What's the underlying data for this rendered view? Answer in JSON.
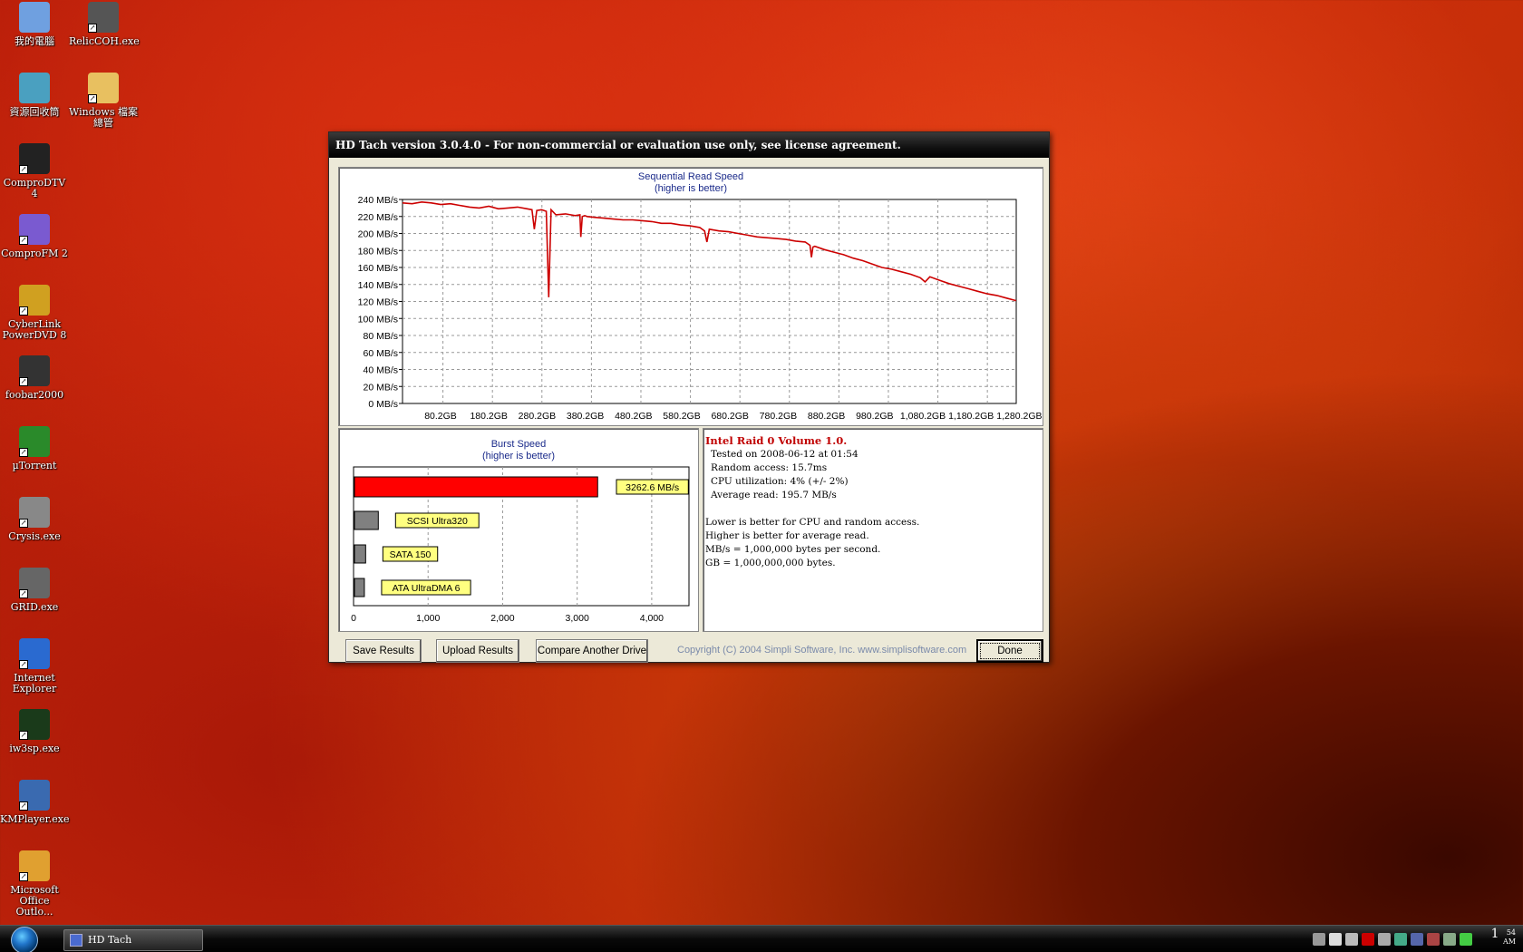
{
  "desktop": {
    "icons": [
      {
        "label": "我的電腦",
        "icon": "my-computer-icon"
      },
      {
        "label": "RelicCOH.exe",
        "icon": "coh-icon"
      },
      {
        "label": "資源回收筒",
        "icon": "recycle-bin-icon"
      },
      {
        "label": "Windows 檔案總管",
        "icon": "explorer-folder-icon"
      },
      {
        "label": "ComproDTV 4",
        "icon": "comprodtv-icon"
      },
      {
        "label": "ComproFM 2",
        "icon": "comprofm-icon"
      },
      {
        "label": "CyberLink PowerDVD 8",
        "icon": "powerdvd-icon"
      },
      {
        "label": "foobar2000",
        "icon": "foobar-icon"
      },
      {
        "label": "µTorrent",
        "icon": "utorrent-icon"
      },
      {
        "label": "Crysis.exe",
        "icon": "crysis-icon"
      },
      {
        "label": "GRID.exe",
        "icon": "grid-icon"
      },
      {
        "label": "Internet Explorer",
        "icon": "ie-icon"
      },
      {
        "label": "iw3sp.exe",
        "icon": "cod4-icon"
      },
      {
        "label": "KMPlayer.exe",
        "icon": "kmplayer-icon"
      },
      {
        "label": "Microsoft Office Outlo...",
        "icon": "outlook-icon"
      }
    ]
  },
  "window": {
    "title": "HD Tach version 3.0.4.0  - For non-commercial or evaluation use only, see license agreement.",
    "buttons": {
      "save": "Save Results",
      "upload": "Upload Results",
      "compare": "Compare Another Drive",
      "done": "Done"
    },
    "copyright": "Copyright (C) 2004 Simpli Software, Inc. www.simplisoftware.com"
  },
  "info": {
    "title": "Intel Raid 0 Volume 1.0.",
    "tested": "Tested on 2008-06-12 at 01:54",
    "random_access": "Random access: 15.7ms",
    "cpu": "CPU utilization: 4% (+/- 2%)",
    "average": "Average read: 195.7 MB/s",
    "note1": "Lower is better for CPU and random access.",
    "note2": "Higher is better for average read.",
    "note3": "MB/s = 1,000,000 bytes per second.",
    "note4": "GB = 1,000,000,000 bytes."
  },
  "chart_data": [
    {
      "type": "line",
      "title": "Sequential Read Speed",
      "subtitle": "(higher is better)",
      "ylim": [
        0,
        240
      ],
      "y_ticks": [
        "0 MB/s",
        "20 MB/s",
        "40 MB/s",
        "60 MB/s",
        "80 MB/s",
        "100 MB/s",
        "120 MB/s",
        "140 MB/s",
        "160 MB/s",
        "180 MB/s",
        "200 MB/s",
        "220 MB/s",
        "240 MB/s"
      ],
      "x_ticks": [
        "80.2GB",
        "180.2GB",
        "280.2GB",
        "380.2GB",
        "480.2GB",
        "580.2GB",
        "680.2GB",
        "780.2GB",
        "880.2GB",
        "980.2GB",
        "1,080.2GB",
        "1,180.2GB",
        "1,280.2GB"
      ],
      "xlim": [
        0,
        1280.2
      ],
      "grid": true,
      "color": "#cc0000",
      "series": [
        {
          "x": [
            0,
            20,
            40,
            60,
            80,
            100,
            120,
            140,
            160,
            180,
            200,
            220,
            240,
            260,
            270,
            275,
            280,
            290,
            300,
            305,
            310,
            320,
            340,
            360,
            370,
            372,
            375,
            380,
            385,
            400,
            420,
            440,
            460,
            480,
            500,
            520,
            540,
            560,
            580,
            600,
            620,
            630,
            635,
            640,
            660,
            680,
            700,
            720,
            740,
            760,
            780,
            800,
            820,
            840,
            850,
            853,
            856,
            860,
            880,
            900,
            920,
            940,
            960,
            980,
            1000,
            1020,
            1040,
            1060,
            1080,
            1090,
            1100,
            1120,
            1140,
            1160,
            1180,
            1200,
            1220,
            1240,
            1260,
            1280
          ],
          "y": [
            236,
            235,
            237,
            236,
            234,
            235,
            233,
            231,
            230,
            232,
            229,
            230,
            231,
            229,
            228,
            205,
            227,
            228,
            226,
            125,
            228,
            222,
            223,
            221,
            222,
            196,
            220,
            221,
            220,
            219,
            218,
            217,
            216,
            216,
            215,
            214,
            212,
            212,
            210,
            209,
            207,
            203,
            190,
            205,
            203,
            202,
            200,
            198,
            196,
            195,
            194,
            193,
            191,
            190,
            186,
            172,
            184,
            185,
            181,
            178,
            175,
            171,
            168,
            164,
            160,
            158,
            155,
            152,
            148,
            143,
            149,
            145,
            141,
            138,
            135,
            132,
            129,
            127,
            124,
            121
          ]
        }
      ]
    },
    {
      "type": "bar",
      "title": "Burst Speed",
      "subtitle": "(higher is better)",
      "categories": [
        "3262.6 MB/s",
        "SCSI Ultra320",
        "SATA 150",
        "ATA UltraDMA 6"
      ],
      "values": [
        3262.6,
        320,
        150,
        133
      ],
      "bar_colors": [
        "#ff0000",
        "#808080",
        "#808080",
        "#808080"
      ],
      "xlim": [
        0,
        4500
      ],
      "x_ticks": [
        "0",
        "1,000",
        "2,000",
        "3,000",
        "4,000"
      ],
      "grid": true
    }
  ],
  "taskbar": {
    "task": "HD Tach",
    "clock_hour": "1",
    "clock_min": "54",
    "clock_ampm": "AM"
  }
}
